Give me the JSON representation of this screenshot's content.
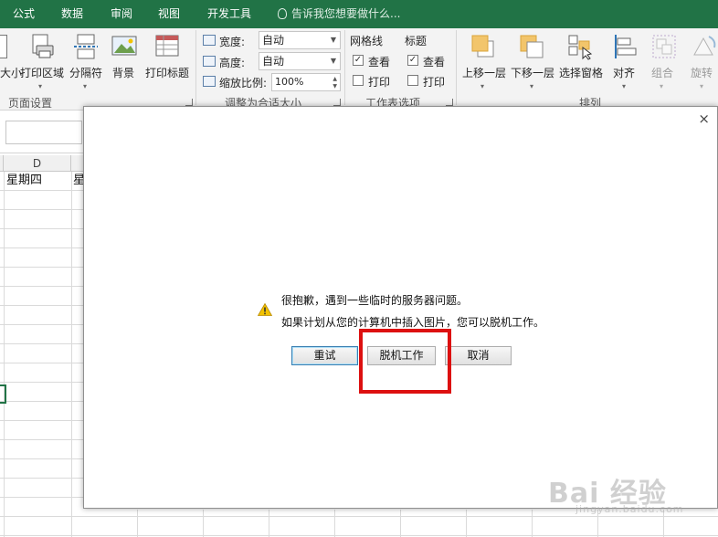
{
  "tabs": [
    "公式",
    "数据",
    "审阅",
    "视图",
    "开发工具"
  ],
  "tell_me": "告诉我您想要做什么...",
  "page_setup": {
    "partial_label": "大小",
    "print_area": "打印区域",
    "breaks": "分隔符",
    "background": "背景",
    "print_titles": "打印标题",
    "group_label": "页面设置"
  },
  "scale_to_fit": {
    "width_label": "宽度:",
    "width_value": "自动",
    "height_label": "高度:",
    "height_value": "自动",
    "scale_label": "缩放比例:",
    "scale_value": "100%",
    "group_label": "调整为合适大小"
  },
  "sheet_options": {
    "gridlines": "网格线",
    "headings": "标题",
    "view": "查看",
    "print": "打印",
    "group_label": "工作表选项"
  },
  "arrange": {
    "bring_forward": "上移一层",
    "send_backward": "下移一层",
    "selection_pane": "选择窗格",
    "align": "对齐",
    "group": "组合",
    "rotate": "旋转",
    "group_label": "排列"
  },
  "grid": {
    "column_d": "D",
    "cell_d1": "星期四",
    "cell_e1_partial": "星"
  },
  "dialog": {
    "close": "×",
    "line1": "很抱歉，遇到一些临时的服务器问题。",
    "line2": "如果计划从您的计算机中插入图片，您可以脱机工作。",
    "retry": "重试",
    "work_offline": "脱机工作",
    "cancel": "取消"
  },
  "watermark": {
    "brand": "Bai 经验",
    "url": "jingyan.baidu.com"
  },
  "colors": {
    "ribbon_green": "#217346",
    "highlight_red": "#dd1010",
    "warning_yellow": "#f2c200"
  }
}
